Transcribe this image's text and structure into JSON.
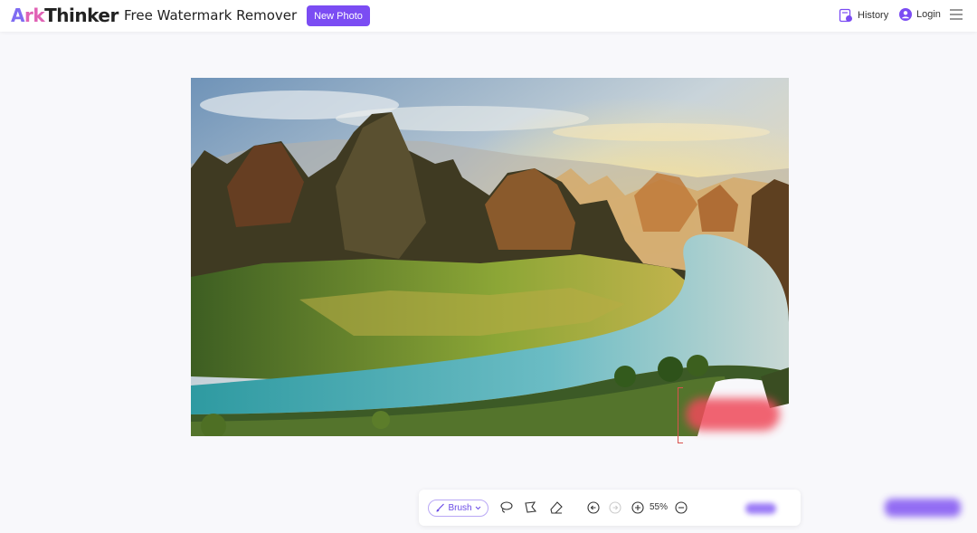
{
  "header": {
    "logo_a": "A",
    "logo_rk": "rk",
    "logo_thinker": "Thinker",
    "title": "Free Watermark Remover",
    "new_photo_label": "New Photo",
    "history_label": "History",
    "login_label": "Login"
  },
  "toolbar": {
    "brush_label": "Brush",
    "zoom_value": "55%"
  },
  "colors": {
    "accent": "#7b4cf3",
    "selection": "#d9534f",
    "mask": "#ef4a5a"
  }
}
